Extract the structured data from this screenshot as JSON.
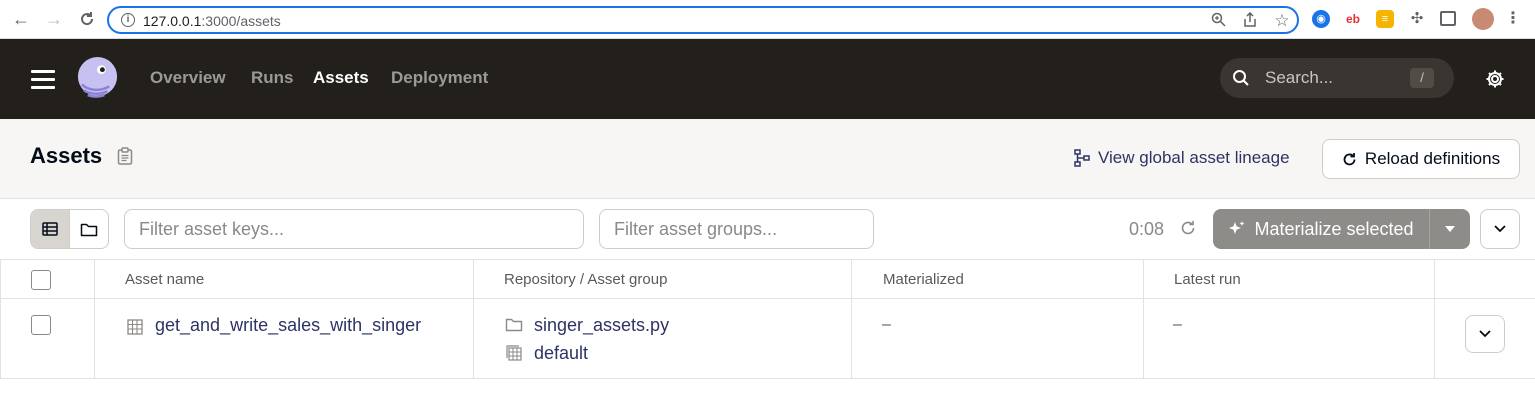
{
  "browser": {
    "url_host": "127.0.0.1",
    "url_path": ":3000/assets"
  },
  "header": {
    "nav": [
      "Overview",
      "Runs",
      "Assets",
      "Deployment"
    ],
    "active_nav": "Assets",
    "search_placeholder": "Search...",
    "search_shortcut": "/"
  },
  "page": {
    "title": "Assets",
    "lineage_link": "View global asset lineage",
    "reload_button": "Reload definitions"
  },
  "toolbar": {
    "filter_keys_placeholder": "Filter asset keys...",
    "filter_groups_placeholder": "Filter asset groups...",
    "refresh_timer": "0:08",
    "materialize_button": "Materialize selected"
  },
  "table": {
    "headers": [
      "Asset name",
      "Repository / Asset group",
      "Materialized",
      "Latest run"
    ],
    "rows": [
      {
        "asset_name": "get_and_write_sales_with_singer",
        "repository": "singer_assets.py",
        "group": "default",
        "materialized": "–",
        "latest_run": "–"
      }
    ]
  },
  "colors": {
    "header_bg": "#231f1b",
    "link": "#2d3464",
    "accent_url": "#1a73e8"
  }
}
